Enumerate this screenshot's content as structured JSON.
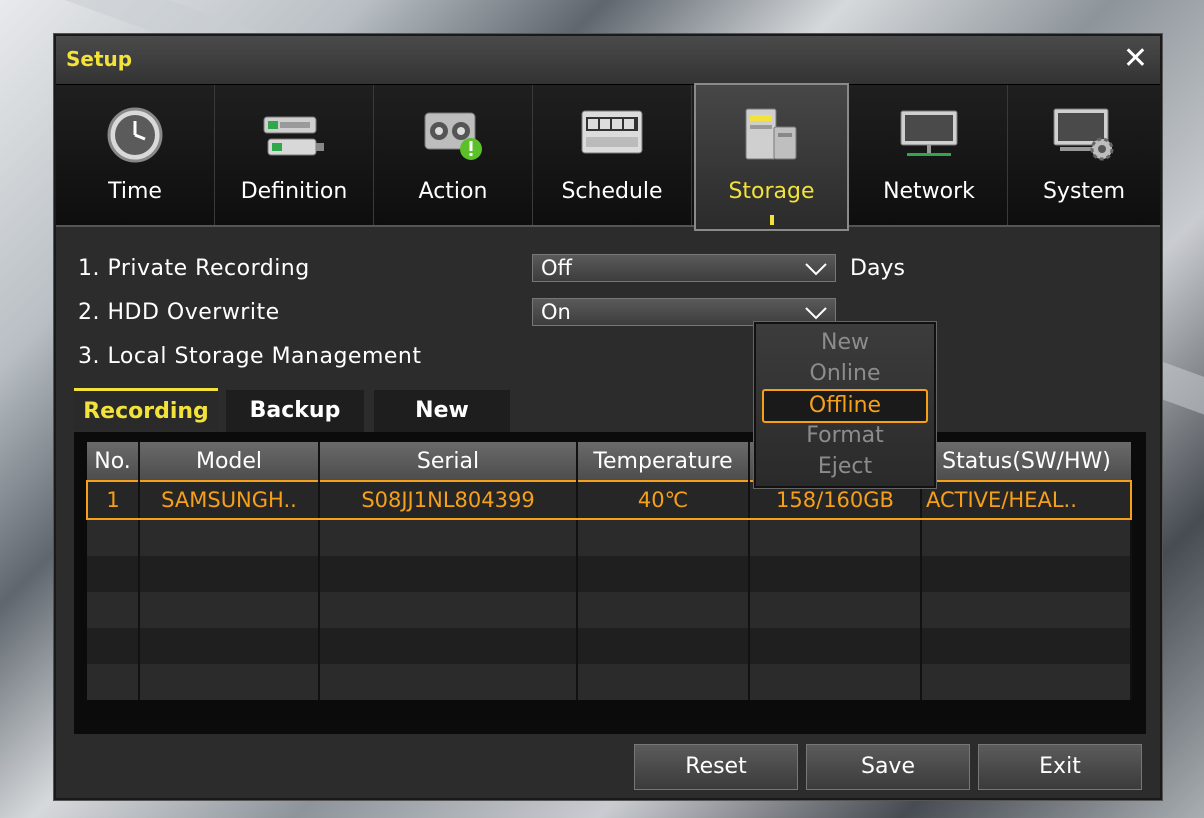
{
  "window": {
    "title": "Setup"
  },
  "tabs": [
    {
      "label": "Time",
      "icon": "clock-icon"
    },
    {
      "label": "Definition",
      "icon": "camera-icon"
    },
    {
      "label": "Action",
      "icon": "alarm-icon"
    },
    {
      "label": "Schedule",
      "icon": "calendar-icon"
    },
    {
      "label": "Storage",
      "icon": "storage-icon",
      "active": true
    },
    {
      "label": "Network",
      "icon": "monitor-icon"
    },
    {
      "label": "System",
      "icon": "system-gear-icon"
    }
  ],
  "settings": {
    "private_recording": {
      "label": "1. Private Recording",
      "value": "Off",
      "unit": "Days"
    },
    "hdd_overwrite": {
      "label": "2. HDD Overwrite",
      "value": "On"
    },
    "local_storage": {
      "label": "3. Local Storage Management"
    }
  },
  "subtabs": [
    "Recording",
    "Backup",
    "New"
  ],
  "table": {
    "headers": [
      "No.",
      "Model",
      "Serial",
      "Temperature",
      "",
      "Status(SW/HW)"
    ],
    "rows": [
      {
        "no": "1",
        "model": "SAMSUNGH..",
        "serial": "S08JJ1NL804399",
        "temperature": "40℃",
        "capacity": "158/160GB",
        "status": "ACTIVE/HEAL.."
      }
    ]
  },
  "dropdown": {
    "options": [
      "New",
      "Online",
      "Offline",
      "Format",
      "Eject"
    ],
    "selected": "Offline"
  },
  "buttons": {
    "reset": "Reset",
    "save": "Save",
    "exit": "Exit"
  },
  "colors": {
    "accent": "#f2e23a",
    "selection": "#f6a01a",
    "status_ok": "#17a61a"
  }
}
